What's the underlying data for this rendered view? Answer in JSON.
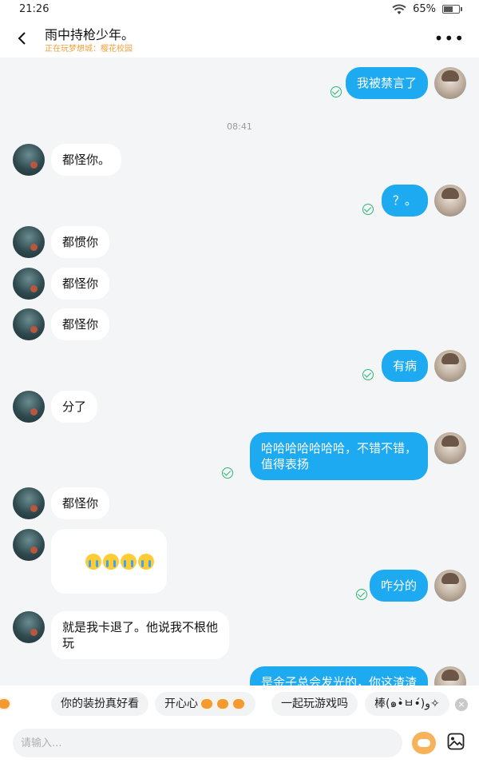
{
  "status_bar": {
    "time": "21:26",
    "battery": "65%",
    "battery_level": 0.65
  },
  "header": {
    "title": "雨中持枪少年。",
    "subtitle": "正在玩梦想城：樱花校园"
  },
  "time_divider": "08:41",
  "messages": [
    {
      "side": "out",
      "text": "我被禁言了"
    },
    {
      "side": "in",
      "text": "都怪你。"
    },
    {
      "side": "out",
      "text": "？。"
    },
    {
      "side": "in",
      "text": "都惯你"
    },
    {
      "side": "in",
      "text": "都怪你"
    },
    {
      "side": "in",
      "text": "都怪你"
    },
    {
      "side": "out",
      "text": "有病"
    },
    {
      "side": "in",
      "text": "分了"
    },
    {
      "side": "out",
      "text": "哈哈哈哈哈哈哈，不错不错，\n值得表扬"
    },
    {
      "side": "in",
      "text": "都怪你"
    },
    {
      "side": "in",
      "text": "",
      "emoji": [
        "loudly-crying-face-icon",
        "loudly-crying-face-icon",
        "loudly-crying-face-icon",
        "loudly-crying-face-icon"
      ]
    },
    {
      "side": "out",
      "text": "咋分的"
    },
    {
      "side": "in",
      "text": "就是我卡退了。他说我不根他\n玩"
    },
    {
      "side": "out",
      "text": "是金子总会发光的，你这渣渣"
    }
  ],
  "quick_replies": [
    {
      "text": "你的装扮真好看"
    },
    {
      "text": "开心心"
    },
    {
      "text": "一起玩游戏吗"
    },
    {
      "text": "棒(๑•̀ㅂ•́)و✧"
    }
  ],
  "input": {
    "placeholder": "请输入..."
  },
  "colors": {
    "outgoing": "#1eaaf1",
    "incoming": "#ffffff",
    "accent_subtitle": "#f0a23b",
    "delivered": "#2bb673"
  }
}
